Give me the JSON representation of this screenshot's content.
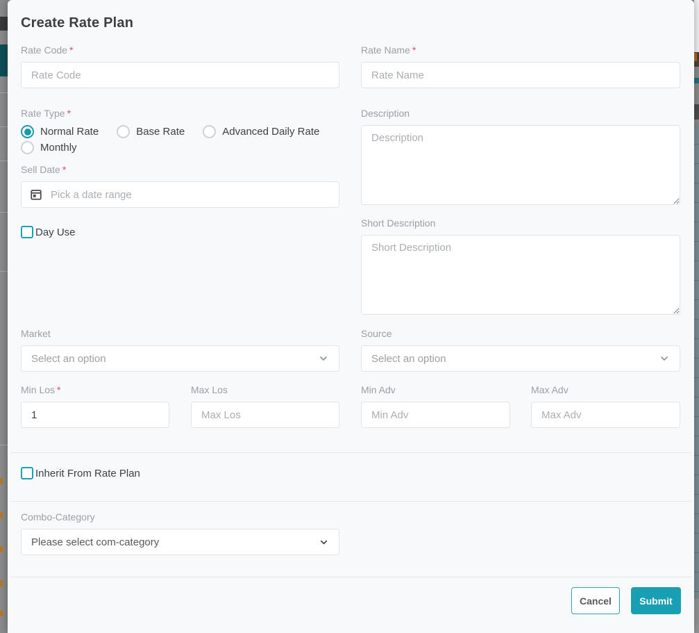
{
  "colors": {
    "accent": "#189fb4",
    "required": "#e8475f",
    "selected_radio": "#1a98a9"
  },
  "modal": {
    "title": "Create Rate Plan",
    "required_marker": "*",
    "rate_code": {
      "label": "Rate Code",
      "placeholder": "Rate Code",
      "required": true
    },
    "rate_name": {
      "label": "Rate Name",
      "placeholder": "Rate Name",
      "required": true
    },
    "rate_type": {
      "label": "Rate Type",
      "required": true,
      "options": [
        "Normal Rate",
        "Base Rate",
        "Advanced Daily Rate",
        "Monthly"
      ],
      "selected": "Normal Rate"
    },
    "description": {
      "label": "Description",
      "placeholder": "Description"
    },
    "sell_date": {
      "label": "Sell Date",
      "placeholder": "Pick a date range",
      "required": true
    },
    "day_use": {
      "label": "Day Use",
      "checked": false
    },
    "short_description": {
      "label": "Short Description",
      "placeholder": "Short Description"
    },
    "market": {
      "label": "Market",
      "value": "Select an option"
    },
    "source": {
      "label": "Source",
      "value": "Select an option"
    },
    "min_los": {
      "label": "Min Los",
      "value": "1",
      "required": true
    },
    "max_los": {
      "label": "Max Los",
      "placeholder": "Max Los"
    },
    "min_adv": {
      "label": "Min Adv",
      "placeholder": "Min Adv"
    },
    "max_adv": {
      "label": "Max Adv",
      "placeholder": "Max Adv"
    },
    "inherit_from_rate_plan": {
      "label": "Inherit From Rate Plan",
      "checked": false
    },
    "combo_category": {
      "label": "Combo-Category",
      "value": "Please select com-category"
    },
    "footer": {
      "cancel_label": "Cancel",
      "submit_label": "Submit"
    }
  }
}
